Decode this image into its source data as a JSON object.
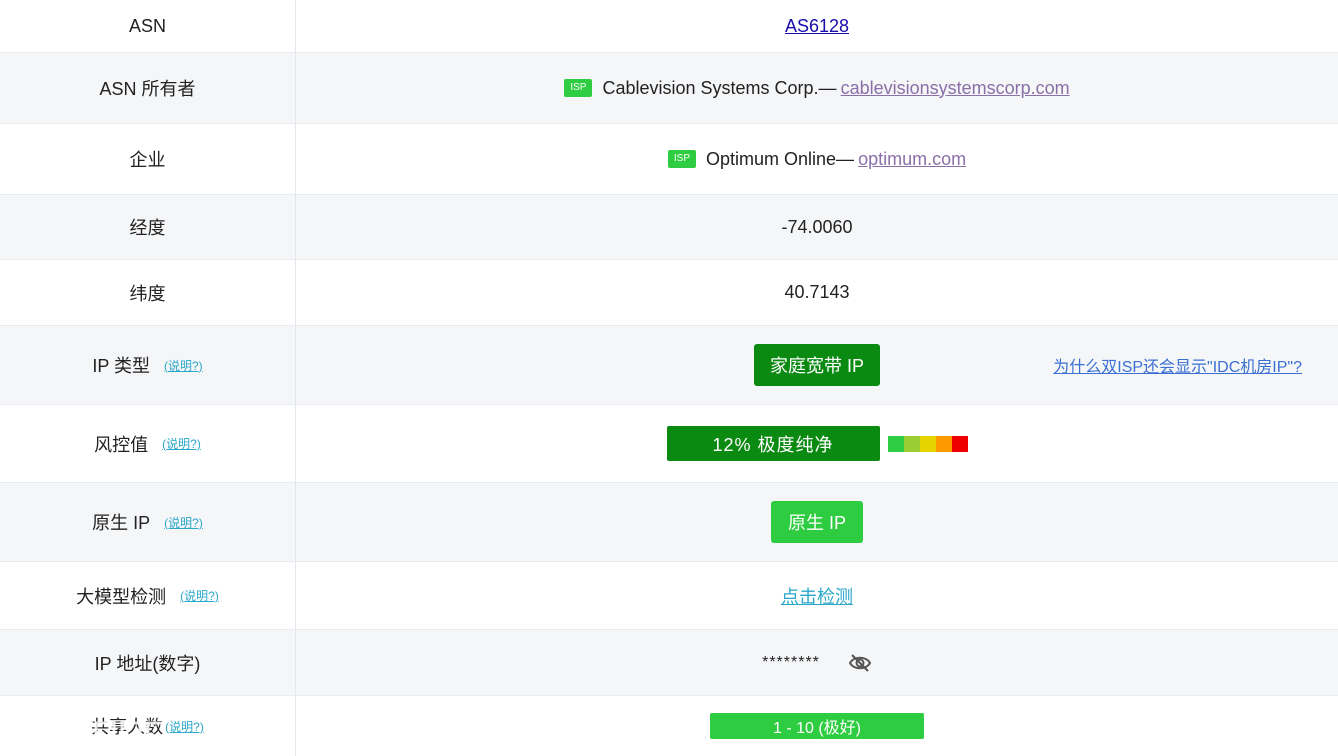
{
  "rows": [
    {
      "label": "ASN",
      "value": "AS6128"
    },
    {
      "label": "ASN 所有者",
      "badge": "ISP",
      "name": "Cablevision Systems Corp.—",
      "domain": "cablevisionsystemscorp.com"
    },
    {
      "label": "企业",
      "badge": "ISP",
      "name": "Optimum Online—",
      "domain": "optimum.com"
    },
    {
      "label": "经度",
      "value": "-74.0060"
    },
    {
      "label": "纬度",
      "value": "40.7143"
    },
    {
      "label": "IP 类型",
      "help": "(说明?)",
      "value": "家庭宽带 IP",
      "side_link": "为什么双ISP还会显示\"IDC机房IP\"?"
    },
    {
      "label": "风控值",
      "help": "(说明?)",
      "value": "12%  极度纯净",
      "percent": 12,
      "scale_colors": [
        "#2ecc40",
        "#9acd32",
        "#e5d400",
        "#ff9900",
        "#ee0000"
      ]
    },
    {
      "label": "原生 IP",
      "help": "(说明?)",
      "value": "原生 IP"
    },
    {
      "label": "大模型检测",
      "help": "(说明?)",
      "value": "点击检测"
    },
    {
      "label": "IP 地址(数字)",
      "value": "********",
      "icon": "eye-slash-icon"
    },
    {
      "label": "共享人数",
      "help": "(说明?)",
      "value": "1 - 10 (极好)"
    }
  ],
  "colors": {
    "green_dark": "#0b8a12",
    "green_light": "#2ecc40",
    "link_blue": "#1a0dab",
    "help_cyan": "#2aa7c9"
  }
}
